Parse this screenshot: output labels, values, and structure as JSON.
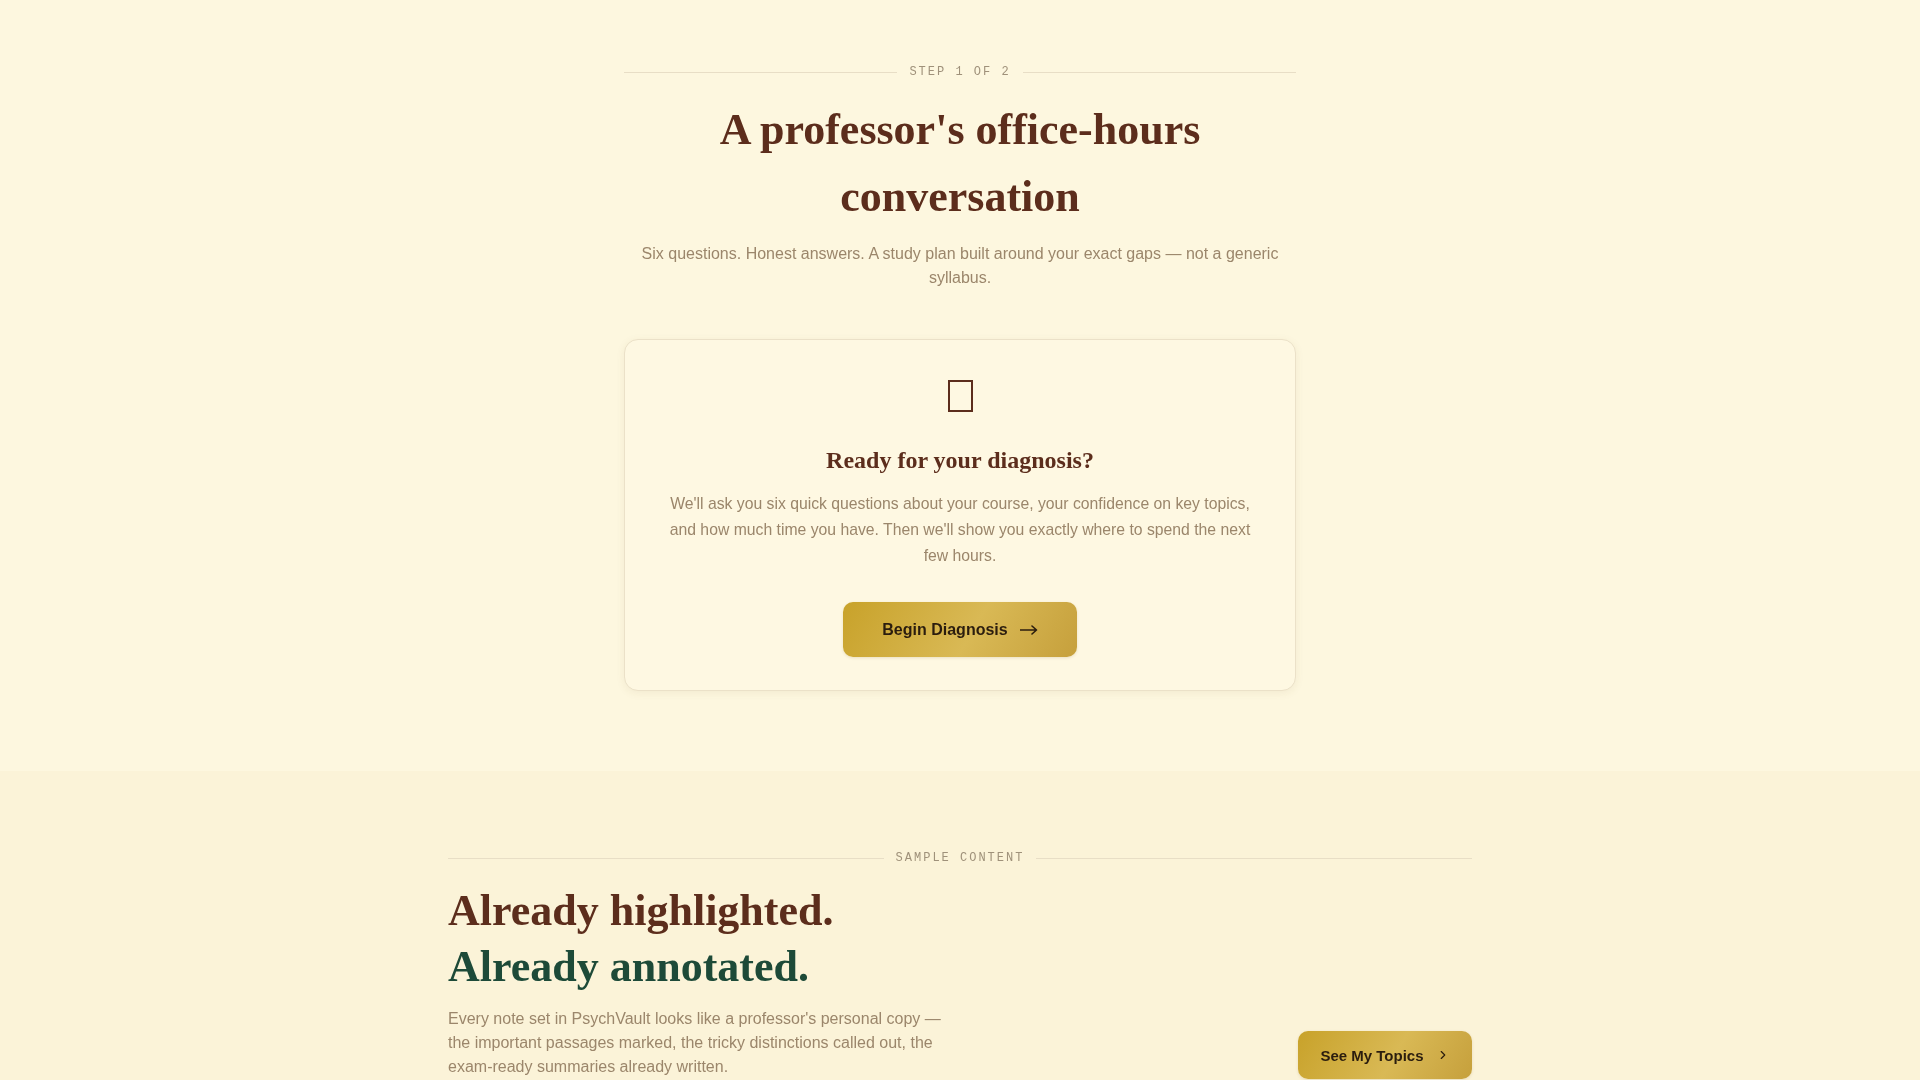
{
  "step_label": "STEP 1 OF 2",
  "title": "A professor's office-hours conversation",
  "subtitle": "Six questions. Honest answers. A study plan built around your exact gaps — not a generic syllabus.",
  "diagnosis_card": {
    "heading": "Ready for your diagnosis?",
    "body": "We'll ask you six quick questions about your course, your confidence on key topics, and how much time you have. Then we'll show you exactly where to spend the next few hours.",
    "button": "Begin Diagnosis"
  },
  "sample_section": {
    "label": "SAMPLE CONTENT",
    "headline": [
      {
        "text": "Already highlighted.",
        "color": "#5c2d1c"
      },
      {
        "text": "Already annotated.",
        "color": "#1d4a38"
      }
    ],
    "body": "Every note set in PsychVault looks like a professor's personal copy — the important passages marked, the tricky distinctions called out, the exam-ready summaries already written.",
    "button": "See My Topics"
  }
}
